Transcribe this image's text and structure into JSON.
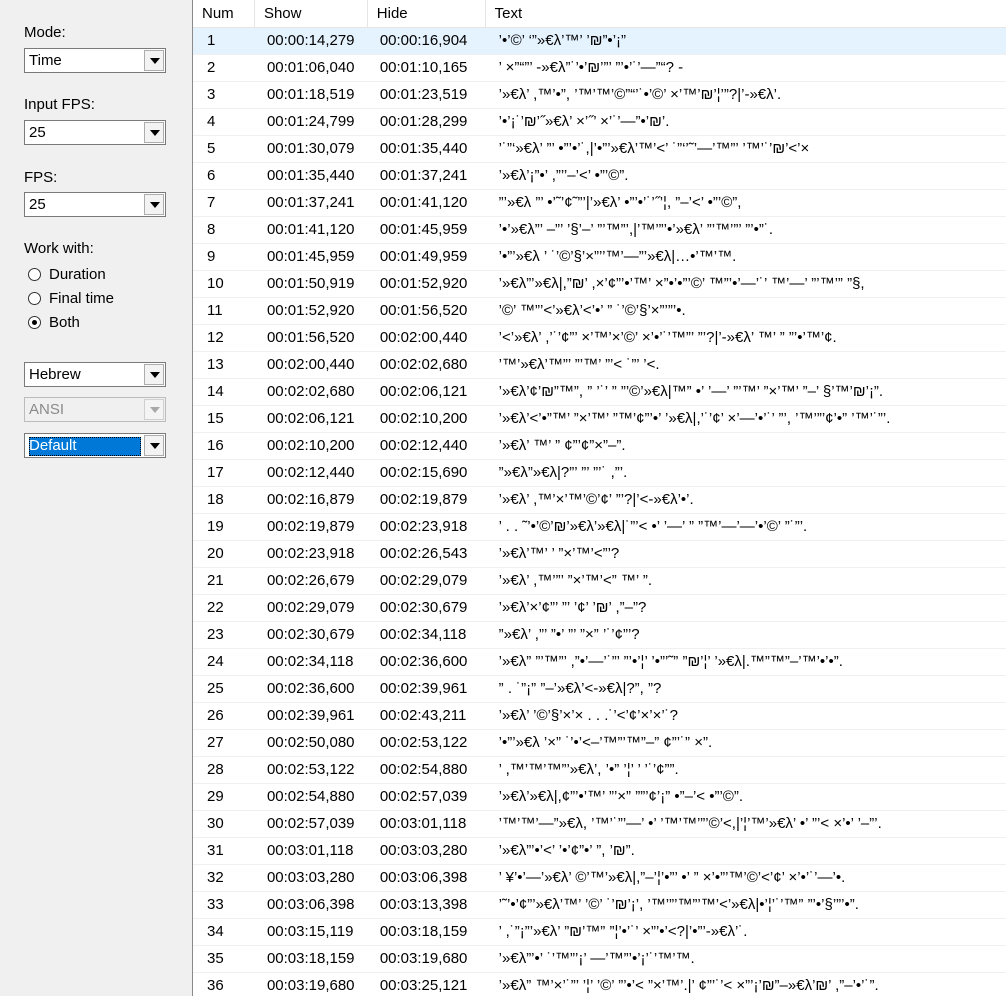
{
  "left_panel": {
    "mode_label": "Mode:",
    "mode_value": "Time",
    "input_fps_label": "Input FPS:",
    "input_fps_value": "25",
    "fps_label": "FPS:",
    "fps_value": "25",
    "work_with_label": "Work with:",
    "radio_duration": "Duration",
    "radio_final_time": "Final time",
    "radio_both": "Both",
    "selected_radio": "Both",
    "language_value": "Hebrew",
    "encoding_value": "ANSI",
    "style_value": "Default"
  },
  "grid": {
    "columns": [
      "Num",
      "Show",
      "Hide",
      "Text"
    ],
    "rows": [
      {
        "num": "1",
        "show": "00:00:14,279",
        "hide": "00:00:16,904",
        "text": "’•’©’ ‘”»€λ’™’ ’₪”•’¡”"
      },
      {
        "num": "2",
        "show": "00:01:06,040",
        "hide": "00:01:10,165",
        "text": "’ ×”“”’ -»€λ”˙’•’₪’”’ ”’•’˙’—”“? -"
      },
      {
        "num": "3",
        "show": "00:01:18,519",
        "hide": "00:01:23,519",
        "text": "’»€λ’ ,™’•”, ’™’™’©”“’˙•’©’ ×’™’₪’¦’”?|’-»€λ’."
      },
      {
        "num": "4",
        "show": "00:01:24,799",
        "hide": "00:01:28,299",
        "text": "’•’¡˙’₪’˝»€λ’ ×’˝’ ×’˙’—”•’₪’."
      },
      {
        "num": "5",
        "show": "00:01:30,079",
        "hide": "00:01:35,440",
        "text": "’˙”‘»€λ’ ”’ •”’•’˙,|’•”’»€λ’™’<’ ˙”‘’˜’—’™”’ ’™’˙’₪’<’×"
      },
      {
        "num": "6",
        "show": "00:01:35,440",
        "hide": "00:01:37,241",
        "text": "’»€λ’¡”•’ ,”’’–’<’ •”’©”."
      },
      {
        "num": "7",
        "show": "00:01:37,241",
        "hide": "00:01:41,120",
        "text": "”’»€λ ”’ •’˜’¢˜”’|’»€λ’ •”’•’˙’˝’¦, ”–’<’ •”’©”,"
      },
      {
        "num": "8",
        "show": "00:01:41,120",
        "hide": "00:01:45,959",
        "text": "’•’»€λ”’ –”’ ’§’–’ ”’™”’,|’™’”’•’»€λ’ ”’™’”’ ”’•”˙."
      },
      {
        "num": "9",
        "show": "00:01:45,959",
        "hide": "00:01:49,959",
        "text": "’•”’»€λ ’ ˙’©’§’×”’’™’—”’»€λ|…•’™’™."
      },
      {
        "num": "10",
        "show": "00:01:50,919",
        "hide": "00:01:52,920",
        "text": "’»€λ”’»€λ|,”₪’ ,×’¢”’•’™’ ×”•’•”’©’ ™”’•’—’˙’ ™’—’ ”’™’” ”§,"
      },
      {
        "num": "11",
        "show": "00:01:52,920",
        "hide": "00:01:56,520",
        "text": "’©’ ™”’<’»€λ’<’•’ ” ˙’©’§’×”’”’•."
      },
      {
        "num": "12",
        "show": "00:01:56,520",
        "hide": "00:02:00,440",
        "text": "’<’»€λ’ ,’˙’¢”’ ×’™’×’©’ ×’•’˙’™”’ ”’?|’-»€λ’ ™’ ” ”’•’™’¢."
      },
      {
        "num": "13",
        "show": "00:02:00,440",
        "hide": "00:02:02,680",
        "text": "’™’»€λ’™”’ ”’™’ ”’< ˙”’ ’<."
      },
      {
        "num": "14",
        "show": "00:02:02,680",
        "hide": "00:02:06,121",
        "text": "’»€λ’¢’₪”™”, ” ’˙’ ” ”’©’»€λ|™” •’ ’—’ ”’™’ ”×’™’ ”–’ §’™’₪’¡”."
      },
      {
        "num": "15",
        "show": "00:02:06,121",
        "hide": "00:02:10,200",
        "text": "’»€λ’<’•”™’ ”×’™’ ”™’¢”’•’ ’»€λ|,’˙’¢’ ×’—’•’˙’ ”’, ’™’”’¢’•” ’™’˙”’."
      },
      {
        "num": "16",
        "show": "00:02:10,200",
        "hide": "00:02:12,440",
        "text": "’»€λ’ ™’ ” ¢”’¢”×”–”."
      },
      {
        "num": "17",
        "show": "00:02:12,440",
        "hide": "00:02:15,690",
        "text": "”»€λ”»€λ|?”’ ”’ ”’˙ ,”’."
      },
      {
        "num": "18",
        "show": "00:02:16,879",
        "hide": "00:02:19,879",
        "text": "’»€λ’ ,™’×’™’©’¢’ ”’?|’<-»€λ’•’."
      },
      {
        "num": "19",
        "show": "00:02:19,879",
        "hide": "00:02:23,918",
        "text": "’ . . ˜’•’©’₪’»€λ’»€λ|˙”’< •’ ’—’ ” ”™’—’—’•’©’ ”˙”’."
      },
      {
        "num": "20",
        "show": "00:02:23,918",
        "hide": "00:02:26,543",
        "text": "’»€λ’™’ ’ ”×’™’<”’?"
      },
      {
        "num": "21",
        "show": "00:02:26,679",
        "hide": "00:02:29,079",
        "text": "’»€λ’ ,™’”’ ”×’™’<” ™’ ”."
      },
      {
        "num": "22",
        "show": "00:02:29,079",
        "hide": "00:02:30,679",
        "text": "’»€λ’×’¢”’ ”’ ’¢’ ’₪’ ,”–”?"
      },
      {
        "num": "23",
        "show": "00:02:30,679",
        "hide": "00:02:34,118",
        "text": "”»€λ’ ,”’ ”•’ ”’ ”×” ’˙’¢”’?"
      },
      {
        "num": "24",
        "show": "00:02:34,118",
        "hide": "00:02:36,600",
        "text": "’»€λ” ”’™”’ ,”•’—’˙”’ ”’•’¦’ ’•”’˜” ”₪’¦’ ’»€λ|.™”™”–’™’•’•”."
      },
      {
        "num": "25",
        "show": "00:02:36,600",
        "hide": "00:02:39,961",
        "text": "” . ˙”¡” ”–’»€λ’<-»€λ|?”, ”?"
      },
      {
        "num": "26",
        "show": "00:02:39,961",
        "hide": "00:02:43,211",
        "text": "’»€λ’ ’©’§’×’× . . .˙’<’¢’×’×’˙?"
      },
      {
        "num": "27",
        "show": "00:02:50,080",
        "hide": "00:02:53,122",
        "text": "’•”’»€λ ’×” ˙’•’<–’™”’™”–” ¢”’˙” ×”."
      },
      {
        "num": "28",
        "show": "00:02:53,122",
        "hide": "00:02:54,880",
        "text": "’ ,™’™’™”’»€λ’, ’•” ’¦’ ’ ’˙’¢””."
      },
      {
        "num": "29",
        "show": "00:02:54,880",
        "hide": "00:02:57,039",
        "text": "’»€λ’»€λ|,¢”’•’™’ ”’×” ””’¢’¡” •”–’< •”’©”."
      },
      {
        "num": "30",
        "show": "00:02:57,039",
        "hide": "00:03:01,118",
        "text": "’™’™’—”»€λ, ’™’˙”’—’ •’ ’™’™’”’©’<,|’¦’™’»€λ’ •’ ”’< ×’•’ ’–”’."
      },
      {
        "num": "31",
        "show": "00:03:01,118",
        "hide": "00:03:03,280",
        "text": "’»€λ”’•’<’ ’•’¢”•’ ”, ’₪”."
      },
      {
        "num": "32",
        "show": "00:03:03,280",
        "hide": "00:03:06,398",
        "text": "’ ¥’•’—’»€λ’ ©’™’»€λ|,”–’¦’•”’ •’ ” ×’•”’™’©’<’¢’ ×’•’˙’—’•."
      },
      {
        "num": "33",
        "show": "00:03:06,398",
        "hide": "00:03:13,398",
        "text": "’˜’•’¢”’»€λ’™’ ’©’ ˙’₪’¡’, ’™’”’™”’™’<’»€λ|•’¦’˙’™” ”’•’§’”’•”."
      },
      {
        "num": "34",
        "show": "00:03:15,119",
        "hide": "00:03:18,159",
        "text": "’ ,˙”¡”’»€λ’ ”₪’™” ”¦’•’˙’ ×”’•’<?|’•”’-»€λ’˙."
      },
      {
        "num": "35",
        "show": "00:03:18,159",
        "hide": "00:03:19,680",
        "text": "’»€λ”’•’ ˙’™”’¡’ —’™”’•’¡’˙’™’™."
      },
      {
        "num": "36",
        "show": "00:03:19,680",
        "hide": "00:03:25,121",
        "text": "’»€λ” ™’×’˙”’ ’¦’ ’©’ ”’•’< ”×’™’.|’ ¢”’˙’< ×”’¡’₪”–»€λ’₪’ ,”–’•’˙”."
      }
    ]
  }
}
